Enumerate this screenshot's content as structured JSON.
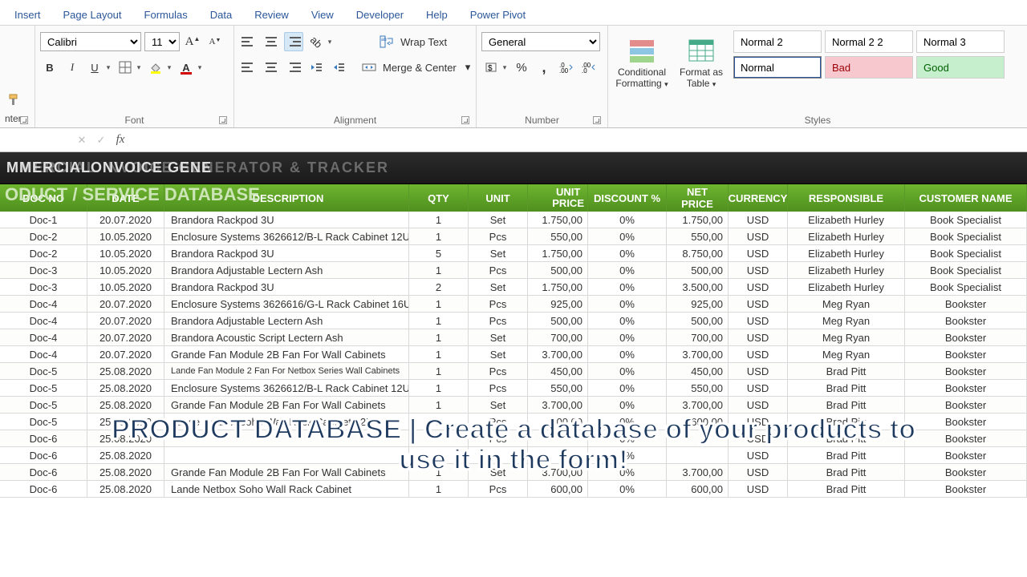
{
  "tabs": [
    "Insert",
    "Page Layout",
    "Formulas",
    "Data",
    "Review",
    "View",
    "Developer",
    "Help",
    "Power Pivot"
  ],
  "ribbon": {
    "clipboard_label_partial": "nter",
    "font": {
      "name": "Calibri",
      "size": "11",
      "group_label": "Font"
    },
    "alignment": {
      "wrap": "Wrap Text",
      "merge": "Merge & Center",
      "group_label": "Alignment"
    },
    "number": {
      "format": "General",
      "group_label": "Number"
    },
    "styles": {
      "cond": "Conditional Formatting",
      "table": "Format as Table",
      "cells": [
        "Normal 2",
        "Normal 2 2",
        "Normal 3",
        "Normal",
        "Bad",
        "Good"
      ],
      "colors": [
        "#ffffff",
        "#ffffff",
        "#ffffff",
        "#ffffff",
        "#f7c8ce",
        "#c6efce"
      ],
      "textcolors": [
        "#000",
        "#000",
        "#000",
        "#000",
        "#9c0006",
        "#006100"
      ],
      "group_label": "Styles"
    }
  },
  "banner_ghost": "MMERCIAL INVOICE GENERATOR & TRACKER",
  "banner_front": "MMERCIALONVOICE GENE",
  "db_title": "ODUCT / SERVICE DATABASE",
  "columns": [
    "DOC NO",
    "DATE",
    "DESCRIPTION",
    "QTY",
    "UNIT",
    "UNIT PRICE",
    "DISCOUNT %",
    "NET PRICE",
    "CURRENCY",
    "RESPONSIBLE",
    "CUSTOMER NAME"
  ],
  "rows": [
    {
      "doc": "Doc-1",
      "date": "20.07.2020",
      "desc": "Brandora Rackpod 3U",
      "qty": "1",
      "unit": "Set",
      "uprice": "1.750,00",
      "disc": "0%",
      "net": "1.750,00",
      "cur": "USD",
      "resp": "Elizabeth Hurley",
      "cust": "Book Specialist"
    },
    {
      "doc": "Doc-2",
      "date": "10.05.2020",
      "desc": "Enclosure Systems 3626612/B-L Rack Cabinet 12U",
      "qty": "1",
      "unit": "Pcs",
      "uprice": "550,00",
      "disc": "0%",
      "net": "550,00",
      "cur": "USD",
      "resp": "Elizabeth Hurley",
      "cust": "Book Specialist"
    },
    {
      "doc": "Doc-2",
      "date": "10.05.2020",
      "desc": "Brandora Rackpod 3U",
      "qty": "5",
      "unit": "Set",
      "uprice": "1.750,00",
      "disc": "0%",
      "net": "8.750,00",
      "cur": "USD",
      "resp": "Elizabeth Hurley",
      "cust": "Book Specialist"
    },
    {
      "doc": "Doc-3",
      "date": "10.05.2020",
      "desc": "Brandora Adjustable Lectern Ash",
      "qty": "1",
      "unit": "Pcs",
      "uprice": "500,00",
      "disc": "0%",
      "net": "500,00",
      "cur": "USD",
      "resp": "Elizabeth Hurley",
      "cust": "Book Specialist"
    },
    {
      "doc": "Doc-3",
      "date": "10.05.2020",
      "desc": "Brandora Rackpod 3U",
      "qty": "2",
      "unit": "Set",
      "uprice": "1.750,00",
      "disc": "0%",
      "net": "3.500,00",
      "cur": "USD",
      "resp": "Elizabeth Hurley",
      "cust": "Book Specialist"
    },
    {
      "doc": "Doc-4",
      "date": "20.07.2020",
      "desc": "Enclosure Systems 3626616/G-L Rack Cabinet 16U",
      "qty": "1",
      "unit": "Pcs",
      "uprice": "925,00",
      "disc": "0%",
      "net": "925,00",
      "cur": "USD",
      "resp": "Meg Ryan",
      "cust": "Bookster"
    },
    {
      "doc": "Doc-4",
      "date": "20.07.2020",
      "desc": "Brandora Adjustable Lectern Ash",
      "qty": "1",
      "unit": "Pcs",
      "uprice": "500,00",
      "disc": "0%",
      "net": "500,00",
      "cur": "USD",
      "resp": "Meg Ryan",
      "cust": "Bookster"
    },
    {
      "doc": "Doc-4",
      "date": "20.07.2020",
      "desc": "Brandora Acoustic Script Lectern Ash",
      "qty": "1",
      "unit": "Set",
      "uprice": "700,00",
      "disc": "0%",
      "net": "700,00",
      "cur": "USD",
      "resp": "Meg Ryan",
      "cust": "Bookster"
    },
    {
      "doc": "Doc-4",
      "date": "20.07.2020",
      "desc": "Grande Fan Module 2B Fan For Wall Cabinets",
      "qty": "1",
      "unit": "Set",
      "uprice": "3.700,00",
      "disc": "0%",
      "net": "3.700,00",
      "cur": "USD",
      "resp": "Meg Ryan",
      "cust": "Bookster"
    },
    {
      "doc": "Doc-5",
      "date": "25.08.2020",
      "desc": "Lande Fan Module 2 Fan For Netbox Series Wall Cabinets",
      "qty": "1",
      "unit": "Pcs",
      "uprice": "450,00",
      "disc": "0%",
      "net": "450,00",
      "cur": "USD",
      "resp": "Brad Pitt",
      "cust": "Bookster",
      "small": true
    },
    {
      "doc": "Doc-5",
      "date": "25.08.2020",
      "desc": "Enclosure Systems 3626612/B-L Rack Cabinet 12U",
      "qty": "1",
      "unit": "Pcs",
      "uprice": "550,00",
      "disc": "0%",
      "net": "550,00",
      "cur": "USD",
      "resp": "Brad Pitt",
      "cust": "Bookster"
    },
    {
      "doc": "Doc-5",
      "date": "25.08.2020",
      "desc": "Grande Fan Module 2B Fan For Wall Cabinets",
      "qty": "1",
      "unit": "Set",
      "uprice": "3.700,00",
      "disc": "0%",
      "net": "3.700,00",
      "cur": "USD",
      "resp": "Brad Pitt",
      "cust": "Bookster"
    },
    {
      "doc": "Doc-5",
      "date": "25.08.2020",
      "desc": "Lande Netbox Soho Wall Rack Cabinet 12U",
      "qty": "1",
      "unit": "Pcs",
      "uprice": "600,00",
      "disc": "0%",
      "net": "600,00",
      "cur": "USD",
      "resp": "Brad Pitt",
      "cust": "Bookster"
    },
    {
      "doc": "Doc-6",
      "date": "25.08.2020",
      "desc": "",
      "qty": "",
      "unit": "Pcs",
      "uprice": "",
      "disc": "0%",
      "net": "",
      "cur": "USD",
      "resp": "Brad Pitt",
      "cust": "Bookster"
    },
    {
      "doc": "Doc-6",
      "date": "25.08.2020",
      "desc": "",
      "qty": "",
      "unit": "",
      "uprice": "",
      "disc": "0%",
      "net": "",
      "cur": "USD",
      "resp": "Brad Pitt",
      "cust": "Bookster"
    },
    {
      "doc": "Doc-6",
      "date": "25.08.2020",
      "desc": "Grande Fan Module 2B Fan For Wall Cabinets",
      "qty": "1",
      "unit": "Set",
      "uprice": "3.700,00",
      "disc": "0%",
      "net": "3.700,00",
      "cur": "USD",
      "resp": "Brad Pitt",
      "cust": "Bookster"
    },
    {
      "doc": "Doc-6",
      "date": "25.08.2020",
      "desc": "Lande Netbox Soho Wall Rack Cabinet",
      "qty": "1",
      "unit": "Pcs",
      "uprice": "600,00",
      "disc": "0%",
      "net": "600,00",
      "cur": "USD",
      "resp": "Brad Pitt",
      "cust": "Bookster"
    }
  ],
  "caption1": "PRODUCT DATABASE | Create a database of your products to",
  "caption2": "use it in the form!"
}
